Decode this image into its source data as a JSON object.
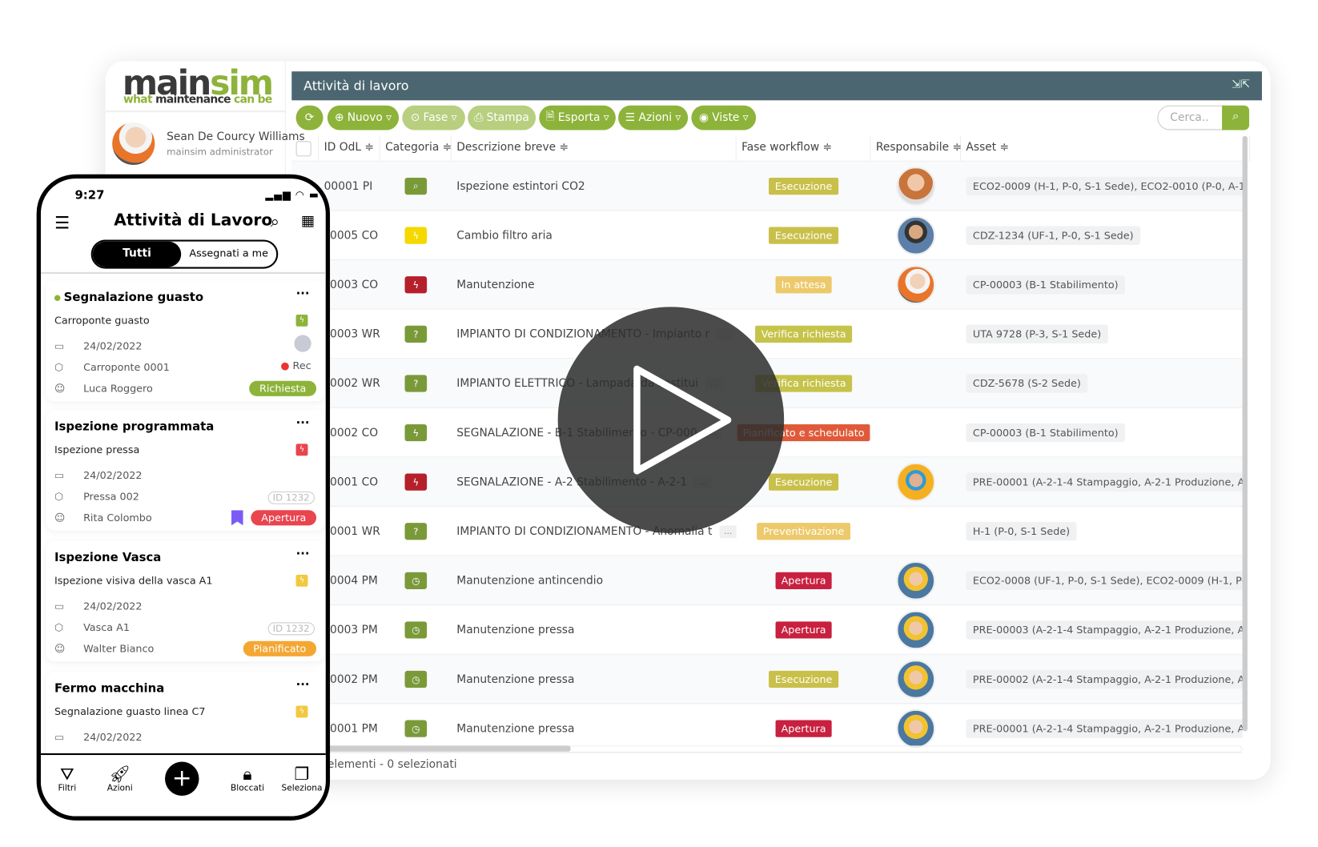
{
  "sidebar": {
    "logo_main_a": "main",
    "logo_main_b": "sim",
    "tagline_a": "what ",
    "tagline_b": "maintenance ",
    "tagline_c": "can be",
    "user_name": "Sean De Courcy Williams",
    "user_role": "mainsim administrator"
  },
  "header": {
    "title": "Attività di lavoro"
  },
  "toolbar": {
    "refresh": "⟳",
    "buttons": [
      {
        "icon": "plus-circle-icon",
        "glyph": "⊕",
        "label": "Nuovo",
        "caret": "▿"
      },
      {
        "icon": "arrow-circle-icon",
        "glyph": "⊙",
        "label": "Fase",
        "caret": "▿"
      },
      {
        "icon": "print-icon",
        "glyph": "⎙",
        "label": "Stampa",
        "caret": ""
      },
      {
        "icon": "file-icon",
        "glyph": "🗎",
        "label": "Esporta",
        "caret": "▿"
      },
      {
        "icon": "list-icon",
        "glyph": "☰",
        "label": "Azioni",
        "caret": "▿"
      },
      {
        "icon": "eye-icon",
        "glyph": "◉",
        "label": "Viste",
        "caret": "▿"
      }
    ],
    "search_placeholder": "Cerca..",
    "search_icon": "⌕"
  },
  "table": {
    "columns": [
      "ID OdL ≑",
      "Categoria ≑",
      "Descrizione breve ≑",
      "Fase workflow ≑",
      "Responsabile ≑",
      "Asset ≑"
    ],
    "rows": [
      {
        "id": "00001 PI",
        "cat": "search",
        "desc": "Ispezione estintori CO2",
        "more": false,
        "fase": "Esecuzione",
        "avatar": "woman",
        "asset": "ECO2-0009 (H-1, P-0, S-1 Sede), ECO2-0010 (P-0, A-1 Uffici"
      },
      {
        "id": "0005 CO",
        "cat": "bolt-yellow",
        "desc": "Cambio filtro aria",
        "more": false,
        "fase": "Esecuzione",
        "avatar": "headphones",
        "asset": "CDZ-1234 (UF-1, P-0, S-1 Sede)"
      },
      {
        "id": "0003 CO",
        "cat": "bolt-red",
        "desc": "Manutenzione",
        "more": false,
        "fase": "In attesa",
        "avatar": "helmet-white",
        "asset": "CP-00003 (B-1 Stabilimento)"
      },
      {
        "id": "0003 WR",
        "cat": "question",
        "desc": "IMPIANTO DI CONDIZIONAMENTO - Impianto r",
        "more": true,
        "fase": "Verifica richiesta",
        "avatar": "",
        "asset": "UTA 9728 (P-3, S-1 Sede)"
      },
      {
        "id": "0002 WR",
        "cat": "question",
        "desc": "IMPIANTO ELETTRICO - Lampada da sostitui",
        "more": true,
        "fase": "Verifica richiesta",
        "avatar": "",
        "asset": "CDZ-5678 (S-2 Sede)"
      },
      {
        "id": "0002 CO",
        "cat": "bolt-green",
        "desc": "SEGNALAZIONE - B-1 Stabilimento - CP-000",
        "more": true,
        "fase": "Pianificato e schedulato",
        "avatar": "",
        "asset": "CP-00003 (B-1 Stabilimento)"
      },
      {
        "id": "0001 CO",
        "cat": "bolt-red",
        "desc": "SEGNALAZIONE - A-2 Stabilimento - A-2-1",
        "more": true,
        "fase": "Esecuzione",
        "avatar": "helmet-blue",
        "asset": "PRE-00001 (A-2-1-4 Stampaggio, A-2-1 Produzione, A-2 Sta"
      },
      {
        "id": "0001 WR",
        "cat": "question",
        "desc": "IMPIANTO DI CONDIZIONAMENTO - Anomalia t",
        "more": true,
        "fase": "Preventivazione",
        "avatar": "",
        "asset": "H-1 (P-0, S-1 Sede)"
      },
      {
        "id": "0004 PM",
        "cat": "clock",
        "desc": "Manutenzione antincendio",
        "more": false,
        "fase": "Apertura",
        "avatar": "helmet-yellow",
        "asset": "ECO2-0008 (UF-1, P-0, S-1 Sede), ECO2-0009 (H-1, P-0, S-1"
      },
      {
        "id": "0003 PM",
        "cat": "clock",
        "desc": "Manutenzione pressa",
        "more": false,
        "fase": "Apertura",
        "avatar": "helmet-yellow",
        "asset": "PRE-00003 (A-2-1-4 Stampaggio, A-2-1 Produzione, A-2 Sta"
      },
      {
        "id": "0002 PM",
        "cat": "clock",
        "desc": "Manutenzione pressa",
        "more": false,
        "fase": "Esecuzione",
        "avatar": "helmet-yellow",
        "asset": "PRE-00002 (A-2-1-4 Stampaggio, A-2-1 Produzione, A-2 Sta"
      },
      {
        "id": "0001 PM",
        "cat": "clock",
        "desc": "Manutenzione pressa",
        "more": false,
        "fase": "Apertura",
        "avatar": "helmet-yellow",
        "asset": "PRE-00001 (A-2-1-4 Stampaggio, A-2-1 Produzione, A-2 Sta"
      }
    ],
    "footer": "elementi - 0 selezionati"
  },
  "colors": {
    "brand": "#8db33a",
    "header": "#4b6670",
    "fase": {
      "Esecuzione": "#c9c04a",
      "In attesa": "#ecc96a",
      "Verifica richiesta": "#c6c34a",
      "Pianificato e schedulato": "#e05a3a",
      "Preventivazione": "#ecc96a",
      "Apertura": "#c8203f"
    }
  },
  "phone": {
    "time": "9:27",
    "status": "▂▄▆ ◠ ▬",
    "title": "Attività di Lavoro",
    "tabs": [
      "Tutti",
      "Assegnati a me"
    ],
    "cards": [
      {
        "title": "Segnalazione guasto",
        "subtitle": "Carroponte guasto",
        "date": "24/02/2022",
        "asset": "Carroponte 0001",
        "person": "Luca Roggero",
        "status": "Richiesta",
        "status_color": "#8db33a",
        "extra": "Rec",
        "id": "",
        "bolt": "#8db33a"
      },
      {
        "title": "Ispezione programmata",
        "subtitle": "Ispezione pressa",
        "date": "24/02/2022",
        "asset": "Pressa 002",
        "person": "Rita Colombo",
        "status": "Apertura",
        "status_color": "#e8454f",
        "extra": "",
        "id": "ID 1232",
        "bolt": "#e8454f"
      },
      {
        "title": "Ispezione Vasca",
        "subtitle": "Ispezione visiva della vasca A1",
        "date": "24/02/2022",
        "asset": "Vasca A1",
        "person": "Walter Bianco",
        "status": "Pianificato",
        "status_color": "#f3a733",
        "extra": "",
        "id": "ID 1232",
        "bolt": "#f1c840"
      },
      {
        "title": "Fermo macchina",
        "subtitle": "Segnalazione guasto linea C7",
        "date": "24/02/2022",
        "asset": "",
        "person": "",
        "status": "",
        "status_color": "",
        "extra": "",
        "id": "",
        "bolt": "#f1c840"
      }
    ],
    "nav": [
      "Filtri",
      "Azioni",
      "Bloccati",
      "Seleziona"
    ],
    "dots": "···"
  }
}
